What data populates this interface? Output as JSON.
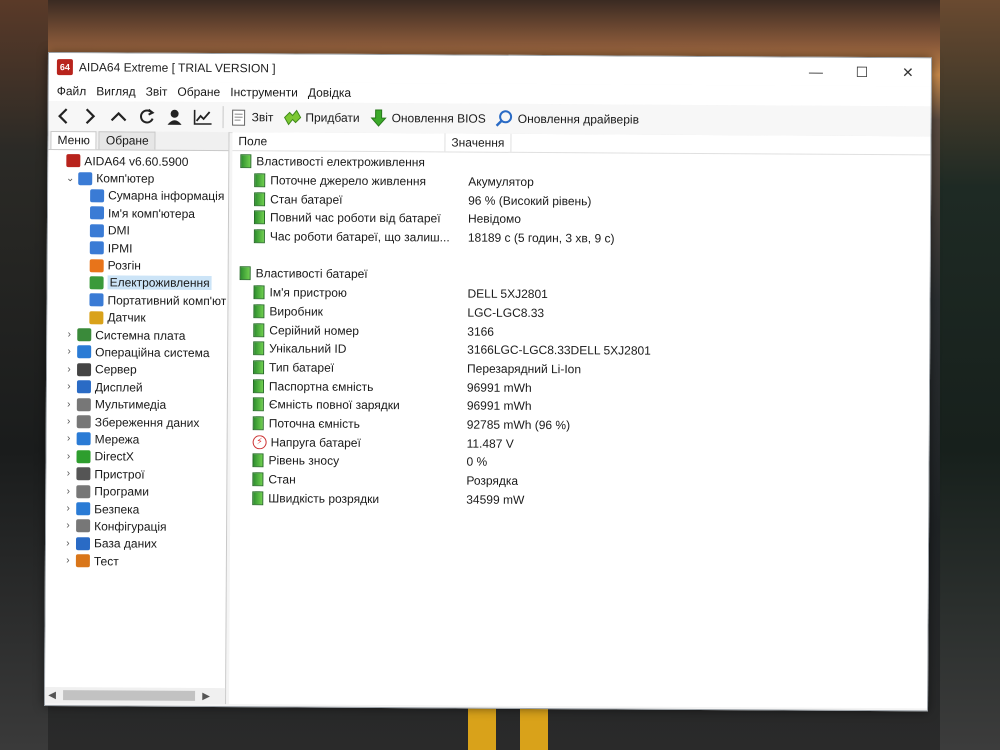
{
  "window": {
    "title": "AIDA64 Extreme  [ TRIAL VERSION ]",
    "logo_text": "64"
  },
  "menubar": [
    "Файл",
    "Вигляд",
    "Звіт",
    "Обране",
    "Інструменти",
    "Довідка"
  ],
  "toolbar": {
    "nav": [
      "back",
      "forward",
      "up",
      "refresh",
      "user",
      "chart"
    ],
    "buttons": [
      {
        "label": "Звіт",
        "icon": "report-icon"
      },
      {
        "label": "Придбати",
        "icon": "buy-icon"
      },
      {
        "label": "Оновлення BIOS",
        "icon": "bios-update-icon"
      },
      {
        "label": "Оновлення драйверів",
        "icon": "driver-update-icon"
      }
    ]
  },
  "left_tabs": [
    "Меню",
    "Обране"
  ],
  "tree": [
    {
      "label": "AIDA64 v6.60.5900",
      "level": 0,
      "expander": "",
      "icon": "aida-icon",
      "color": "#b8231c"
    },
    {
      "label": "Комп'ютер",
      "level": 1,
      "expander": "⌄",
      "icon": "computer-icon",
      "color": "#3a7bd5"
    },
    {
      "label": "Сумарна інформація",
      "level": 2,
      "expander": "",
      "icon": "summary-icon",
      "color": "#3a7bd5"
    },
    {
      "label": "Ім'я комп'ютера",
      "level": 2,
      "expander": "",
      "icon": "computer-name-icon",
      "color": "#3a7bd5"
    },
    {
      "label": "DMI",
      "level": 2,
      "expander": "",
      "icon": "dmi-icon",
      "color": "#3a7bd5"
    },
    {
      "label": "IPMI",
      "level": 2,
      "expander": "",
      "icon": "ipmi-icon",
      "color": "#3a7bd5"
    },
    {
      "label": "Розгін",
      "level": 2,
      "expander": "",
      "icon": "overclock-icon",
      "color": "#e8741a"
    },
    {
      "label": "Електроживлення",
      "level": 2,
      "expander": "",
      "icon": "power-icon",
      "color": "#3a9a3a",
      "selected": true
    },
    {
      "label": "Портативний комп'ют",
      "level": 2,
      "expander": "",
      "icon": "portable-icon",
      "color": "#3a7bd5"
    },
    {
      "label": "Датчик",
      "level": 2,
      "expander": "",
      "icon": "sensor-icon",
      "color": "#d9a21a"
    },
    {
      "label": "Системна плата",
      "level": 1,
      "expander": "›",
      "icon": "motherboard-icon",
      "color": "#3a8a3a"
    },
    {
      "label": "Операційна система",
      "level": 1,
      "expander": "›",
      "icon": "windows-icon",
      "color": "#2a7bd5"
    },
    {
      "label": "Сервер",
      "level": 1,
      "expander": "›",
      "icon": "server-icon",
      "color": "#444444"
    },
    {
      "label": "Дисплей",
      "level": 1,
      "expander": "›",
      "icon": "display-icon",
      "color": "#2a6bc5"
    },
    {
      "label": "Мультимедіа",
      "level": 1,
      "expander": "›",
      "icon": "multimedia-icon",
      "color": "#777777"
    },
    {
      "label": "Збереження даних",
      "level": 1,
      "expander": "›",
      "icon": "storage-icon",
      "color": "#777777"
    },
    {
      "label": "Мережа",
      "level": 1,
      "expander": "›",
      "icon": "network-icon",
      "color": "#2a7bd5"
    },
    {
      "label": "DirectX",
      "level": 1,
      "expander": "›",
      "icon": "directx-icon",
      "color": "#2e9e2e"
    },
    {
      "label": "Пристрої",
      "level": 1,
      "expander": "›",
      "icon": "devices-icon",
      "color": "#555555"
    },
    {
      "label": "Програми",
      "level": 1,
      "expander": "›",
      "icon": "programs-icon",
      "color": "#777777"
    },
    {
      "label": "Безпека",
      "level": 1,
      "expander": "›",
      "icon": "security-icon",
      "color": "#2a7bd5"
    },
    {
      "label": "Конфігурація",
      "level": 1,
      "expander": "›",
      "icon": "config-icon",
      "color": "#777777"
    },
    {
      "label": "База даних",
      "level": 1,
      "expander": "›",
      "icon": "database-icon",
      "color": "#2a6bc5"
    },
    {
      "label": "Тест",
      "level": 1,
      "expander": "›",
      "icon": "test-icon",
      "color": "#d9761a"
    }
  ],
  "columns": {
    "field": "Поле",
    "value": "Значення"
  },
  "rows": [
    {
      "type": "section",
      "field": "Властивості електроживлення",
      "value": "",
      "icon": "battery-icon"
    },
    {
      "type": "item",
      "field": "Поточне джерело живлення",
      "value": "Акумулятор",
      "icon": "battery-icon"
    },
    {
      "type": "item",
      "field": "Стан батареї",
      "value": "96 % (Високий рівень)",
      "icon": "battery-icon"
    },
    {
      "type": "item",
      "field": "Повний час роботи від батареї",
      "value": "Невідомо",
      "icon": "battery-icon"
    },
    {
      "type": "item",
      "field": "Час роботи батареї, що залиш...",
      "value": "18189 с (5 годин, 3 хв, 9 с)",
      "icon": "battery-icon"
    },
    {
      "type": "spacer"
    },
    {
      "type": "section",
      "field": "Властивості батареї",
      "value": "",
      "icon": "battery-icon"
    },
    {
      "type": "item",
      "field": "Ім'я пристрою",
      "value": "DELL 5XJ2801",
      "icon": "battery-icon"
    },
    {
      "type": "item",
      "field": "Виробник",
      "value": "LGC-LGC8.33",
      "icon": "battery-icon"
    },
    {
      "type": "item",
      "field": "Серійний номер",
      "value": "3166",
      "icon": "battery-icon"
    },
    {
      "type": "item",
      "field": "Унікальний ID",
      "value": "3166LGC-LGC8.33DELL 5XJ2801",
      "icon": "battery-icon"
    },
    {
      "type": "item",
      "field": "Тип батареї",
      "value": "Перезарядний Li-Ion",
      "icon": "battery-icon"
    },
    {
      "type": "item",
      "field": "Паспортна ємність",
      "value": "96991 mWh",
      "icon": "battery-icon"
    },
    {
      "type": "item",
      "field": "Ємність повної зарядки",
      "value": "96991 mWh",
      "icon": "battery-icon"
    },
    {
      "type": "item",
      "field": "Поточна ємність",
      "value": "92785 mWh  (96 %)",
      "icon": "battery-icon"
    },
    {
      "type": "item",
      "field": "Напруга батареї",
      "value": "11.487 V",
      "icon": "voltage-icon"
    },
    {
      "type": "item",
      "field": "Рівень зносу",
      "value": "0 %",
      "icon": "battery-icon"
    },
    {
      "type": "item",
      "field": "Стан",
      "value": "Розрядка",
      "icon": "battery-icon"
    },
    {
      "type": "item",
      "field": "Швидкість розрядки",
      "value": "34599 mW",
      "icon": "battery-icon"
    }
  ]
}
